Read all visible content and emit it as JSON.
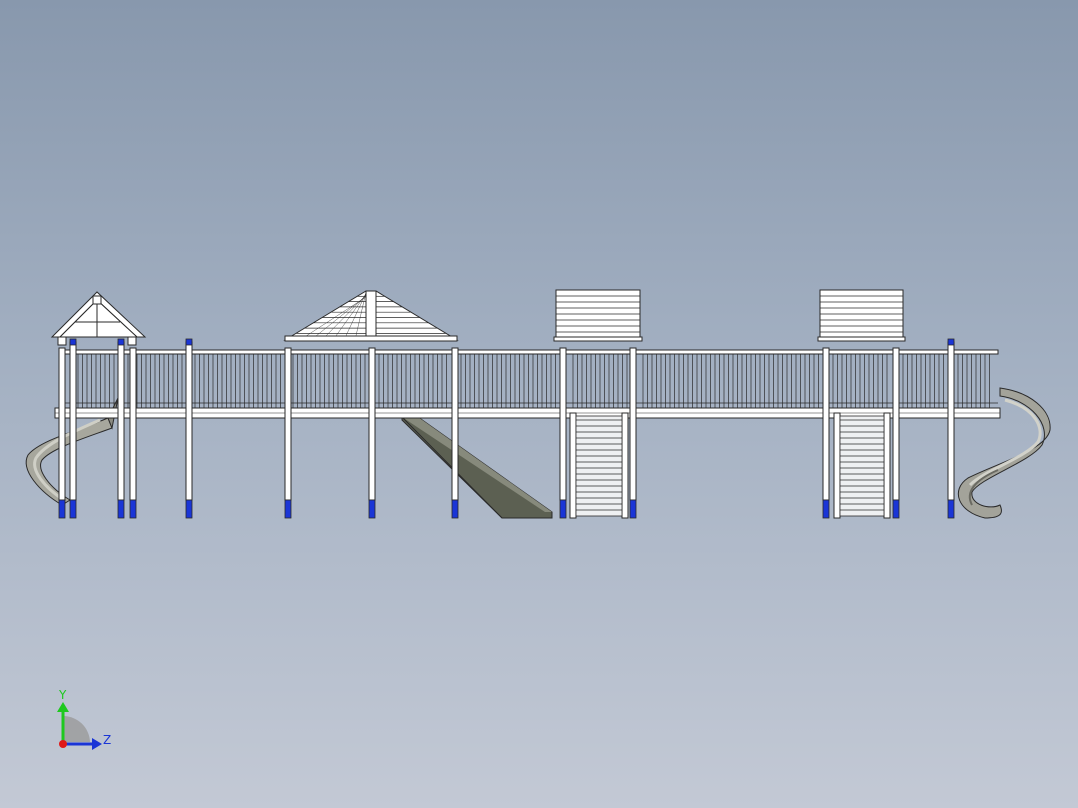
{
  "viewport": {
    "background_top": "#8898ad",
    "background_bottom": "#c3c9d5"
  },
  "model": {
    "structure_color": "#ffffff",
    "outline_color": "#2a2a2a",
    "footing_color": "#1a35d6",
    "slide_color": "#9a9a90",
    "slide_dark": "#5a5e50",
    "modules": [
      {
        "name": "gable-roof-tower"
      },
      {
        "name": "hip-roof-tower"
      },
      {
        "name": "flat-roof-tower-1"
      },
      {
        "name": "flat-roof-tower-2"
      }
    ],
    "slides": [
      {
        "name": "left-spiral-slide"
      },
      {
        "name": "straight-slide"
      },
      {
        "name": "right-spiral-slide"
      }
    ],
    "stairs": [
      {
        "name": "stair-1"
      },
      {
        "name": "stair-2"
      }
    ]
  },
  "triad": {
    "y_label": "Y",
    "z_label": "Z",
    "y_color": "#1ec81e",
    "z_color": "#1a35d6",
    "x_color": "#e01818"
  }
}
